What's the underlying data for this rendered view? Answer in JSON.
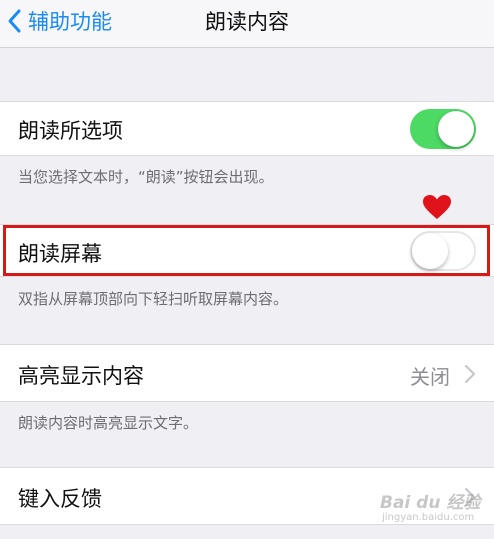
{
  "nav": {
    "back_label": "辅助功能",
    "title": "朗读内容"
  },
  "rows": {
    "speak_selection": {
      "label": "朗读所选项",
      "switch_on": true
    },
    "speak_selection_note": "当您选择文本时，“朗读”按钮会出现。",
    "speak_screen": {
      "label": "朗读屏幕",
      "switch_on": false
    },
    "speak_screen_note": "双指从屏幕顶部向下轻扫听取屏幕内容。",
    "highlight_content": {
      "label": "高亮显示内容",
      "value": "关闭"
    },
    "highlight_content_note": "朗读内容时高亮显示文字。",
    "typing_feedback": {
      "label": "键入反馈"
    }
  },
  "colors": {
    "accent": "#1a8bf5",
    "switch_on": "#4cd964",
    "highlight_border": "#d51a1a",
    "heart": "#e0121a"
  },
  "icons": {
    "back": "chevron-left-icon",
    "disclosure": "chevron-right-icon",
    "annotation": "heart-icon"
  },
  "watermark": {
    "text": "Bai du 经验",
    "sub": "jingyan.baidu.com"
  }
}
